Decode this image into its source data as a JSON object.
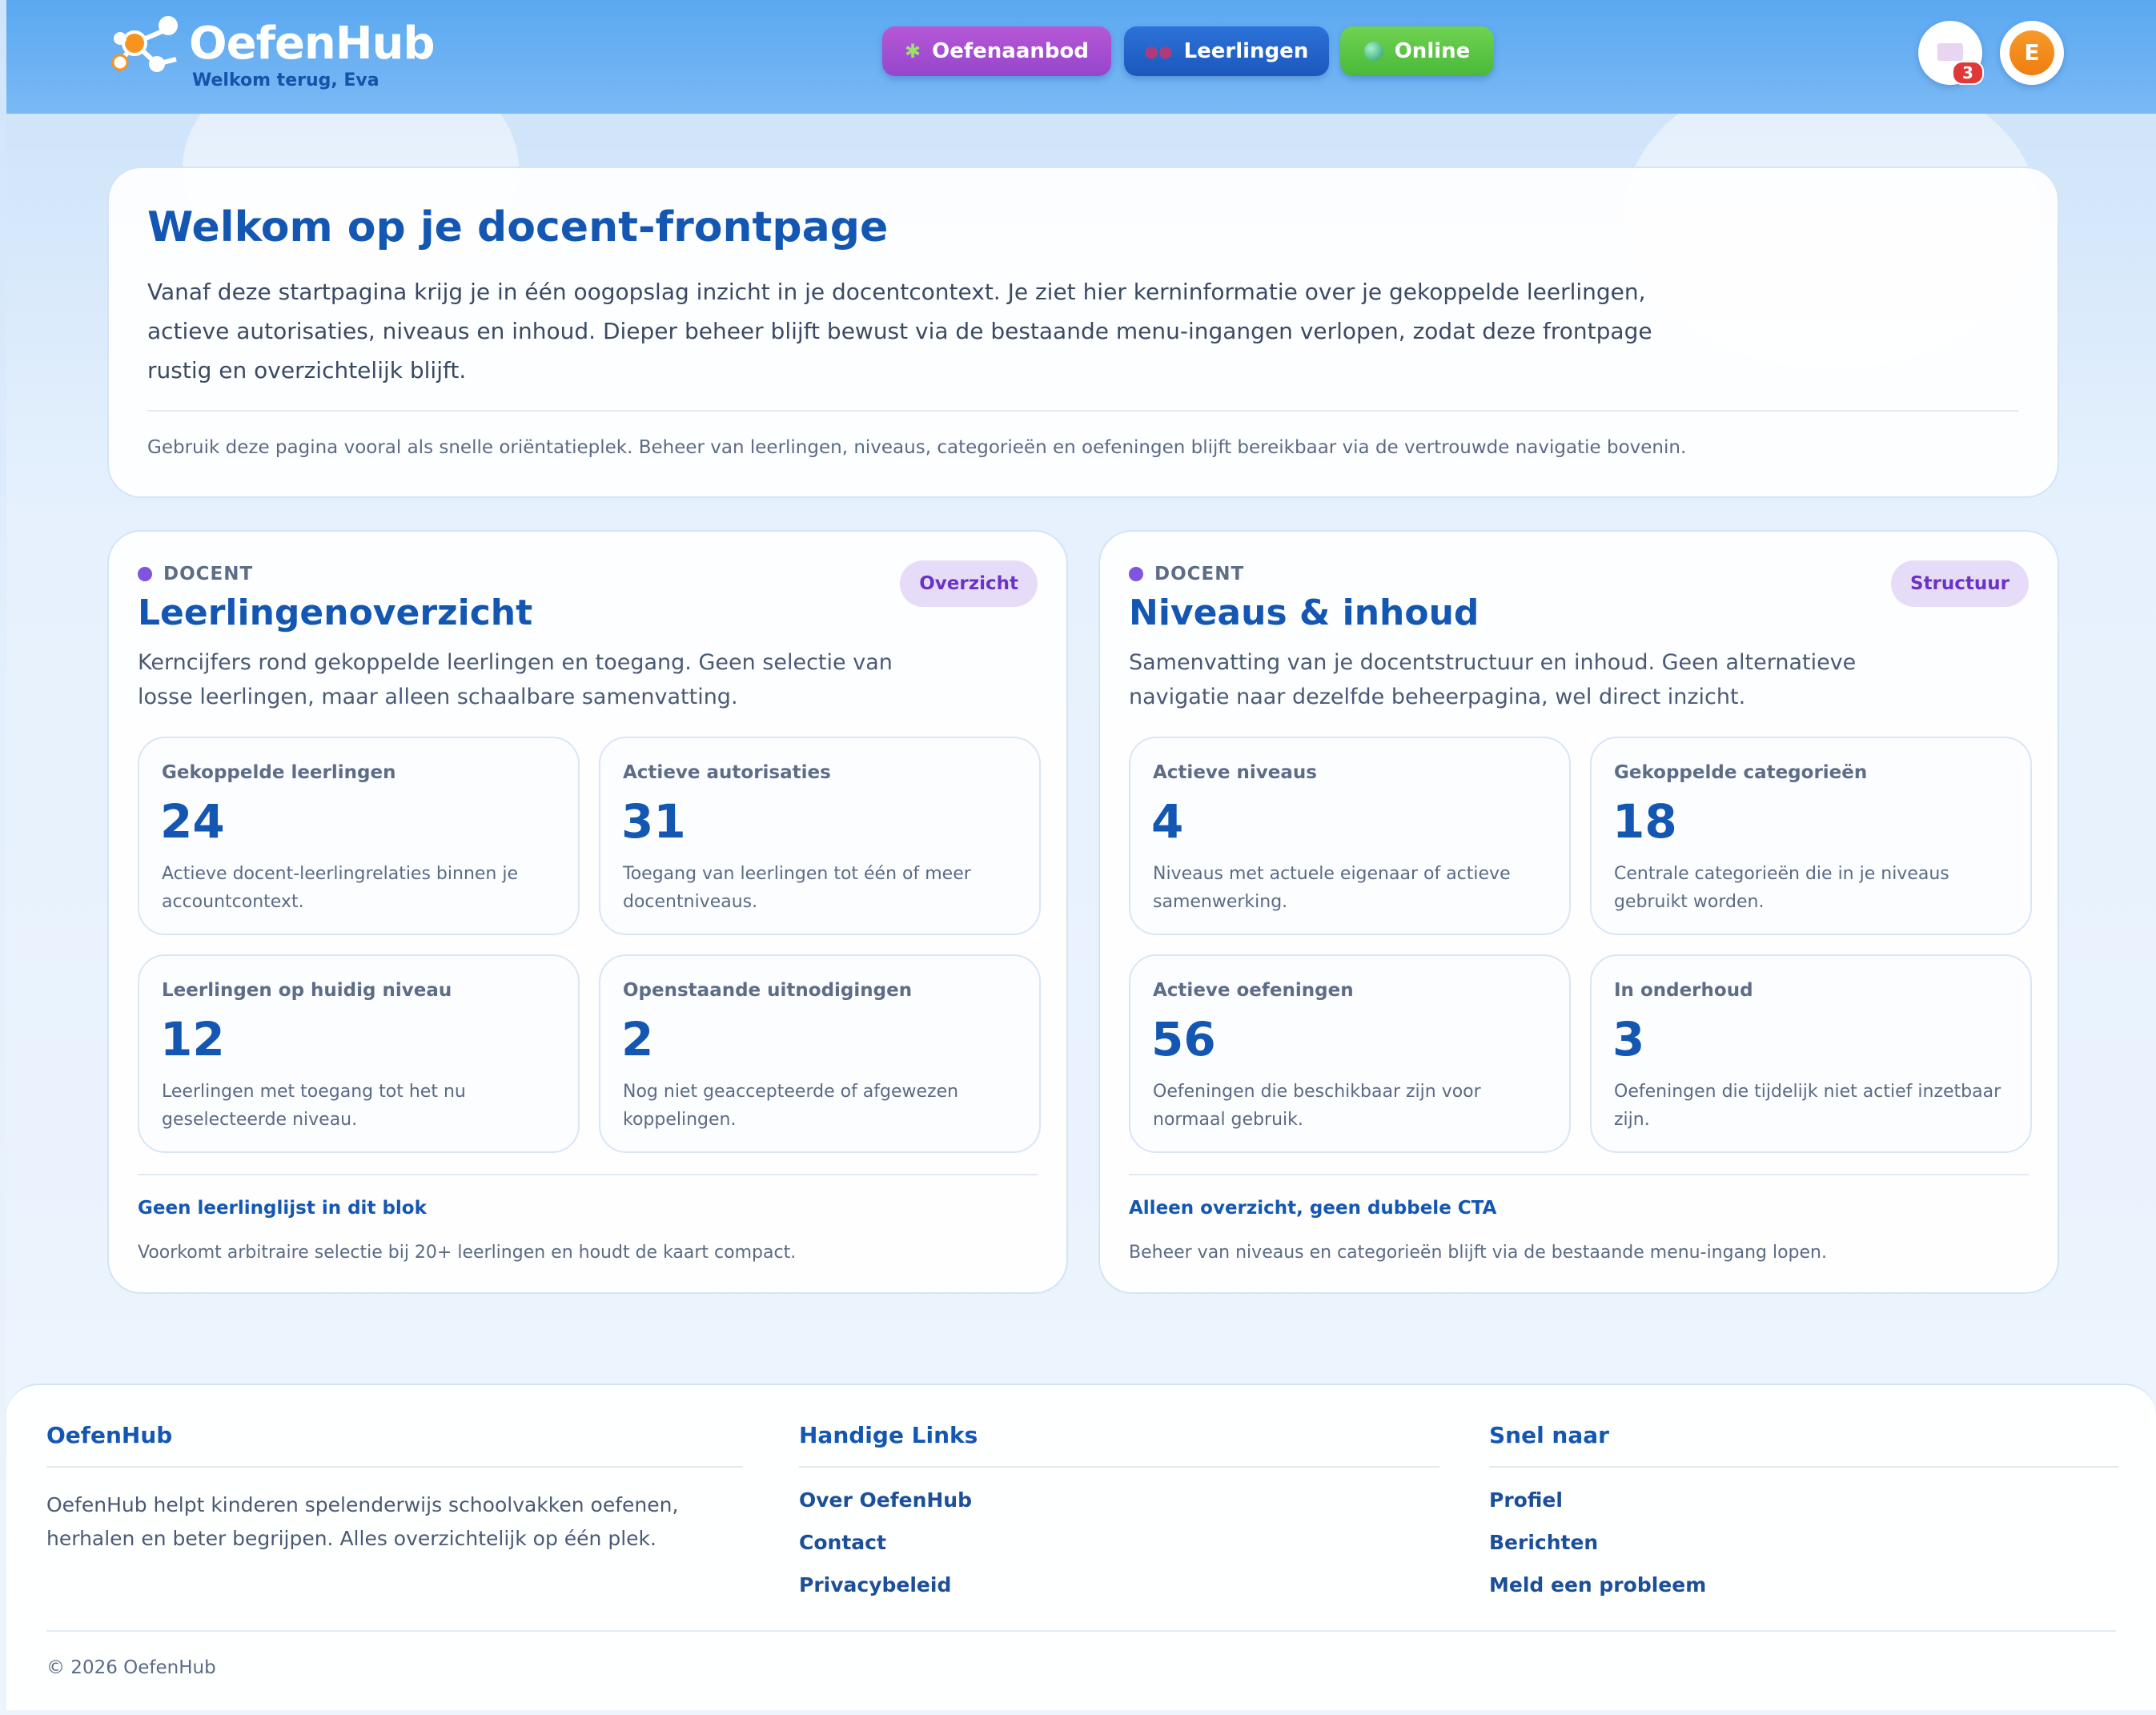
{
  "header": {
    "brand": "OefenHub",
    "welcome": "Welkom terug, Eva",
    "nav": [
      {
        "label": "Oefenaanbod",
        "icon": "puzzle-icon"
      },
      {
        "label": "Leerlingen",
        "icon": "people-icon"
      },
      {
        "label": "Online",
        "icon": "globe-icon"
      }
    ],
    "messages_count": "3",
    "avatar_initial": "E"
  },
  "hero": {
    "title": "Welkom op je docent-frontpage",
    "intro": "Vanaf deze startpagina krijg je in één oogopslag inzicht in je docentcontext. Je ziet hier kerninformatie over je gekoppelde leerlingen, actieve autorisaties, niveaus en inhoud. Dieper beheer blijft bewust via de bestaande menu-ingangen verlopen, zodat deze frontpage rustig en overzichtelijk blijft.",
    "note": "Gebruik deze pagina vooral als snelle oriëntatieplek. Beheer van leerlingen, niveaus, categorieën en oefeningen blijft bereikbaar via de vertrouwde navigatie bovenin."
  },
  "cards": [
    {
      "kicker": "DOCENT",
      "pill": "Overzicht",
      "title": "Leerlingenoverzicht",
      "desc": "Kerncijfers rond gekoppelde leerlingen en toegang. Geen selectie van losse leerlingen, maar alleen schaalbare samenvatting.",
      "stats": [
        {
          "label": "Gekoppelde leerlingen",
          "value": "24",
          "sub": "Actieve docent-leerlingrelaties binnen je accountcontext."
        },
        {
          "label": "Actieve autorisaties",
          "value": "31",
          "sub": "Toegang van leerlingen tot één of meer docentniveaus."
        },
        {
          "label": "Leerlingen op huidig niveau",
          "value": "12",
          "sub": "Leerlingen met toegang tot het nu geselecteerde niveau."
        },
        {
          "label": "Openstaande uitnodigingen",
          "value": "2",
          "sub": "Nog niet geaccepteerde of afgewezen koppelingen."
        }
      ],
      "footer_title": "Geen leerlinglijst in dit blok",
      "footer_note": "Voorkomt arbitraire selectie bij 20+ leerlingen en houdt de kaart compact."
    },
    {
      "kicker": "DOCENT",
      "pill": "Structuur",
      "title": "Niveaus & inhoud",
      "desc": "Samenvatting van je docentstructuur en inhoud. Geen alternatieve navigatie naar dezelfde beheerpagina, wel direct inzicht.",
      "stats": [
        {
          "label": "Actieve niveaus",
          "value": "4",
          "sub": "Niveaus met actuele eigenaar of actieve samenwerking."
        },
        {
          "label": "Gekoppelde categorieën",
          "value": "18",
          "sub": "Centrale categorieën die in je niveaus gebruikt worden."
        },
        {
          "label": "Actieve oefeningen",
          "value": "56",
          "sub": "Oefeningen die beschikbaar zijn voor normaal gebruik."
        },
        {
          "label": "In onderhoud",
          "value": "3",
          "sub": "Oefeningen die tijdelijk niet actief inzetbaar zijn."
        }
      ],
      "footer_title": "Alleen overzicht, geen dubbele CTA",
      "footer_note": "Beheer van niveaus en categorieën blijft via de bestaande menu-ingang lopen."
    }
  ],
  "footer": {
    "col1_title": "OefenHub",
    "col1_text": "OefenHub helpt kinderen spelenderwijs schoolvakken oefenen, herhalen en beter begrijpen. Alles overzichtelijk op één plek.",
    "col2_title": "Handige Links",
    "col2_links": [
      "Over OefenHub",
      "Contact",
      "Privacybeleid"
    ],
    "col3_title": "Snel naar",
    "col3_links": [
      "Profiel",
      "Berichten",
      "Meld een probleem"
    ],
    "copyright": "© 2026 OefenHub"
  },
  "colors": {
    "primary": "#1457b3",
    "header": "#5aa8f1",
    "purple": "#9646cc",
    "blue": "#1b58bd",
    "green": "#4ab93a",
    "badge": "#e03838",
    "avatar": "#ef7e10"
  }
}
